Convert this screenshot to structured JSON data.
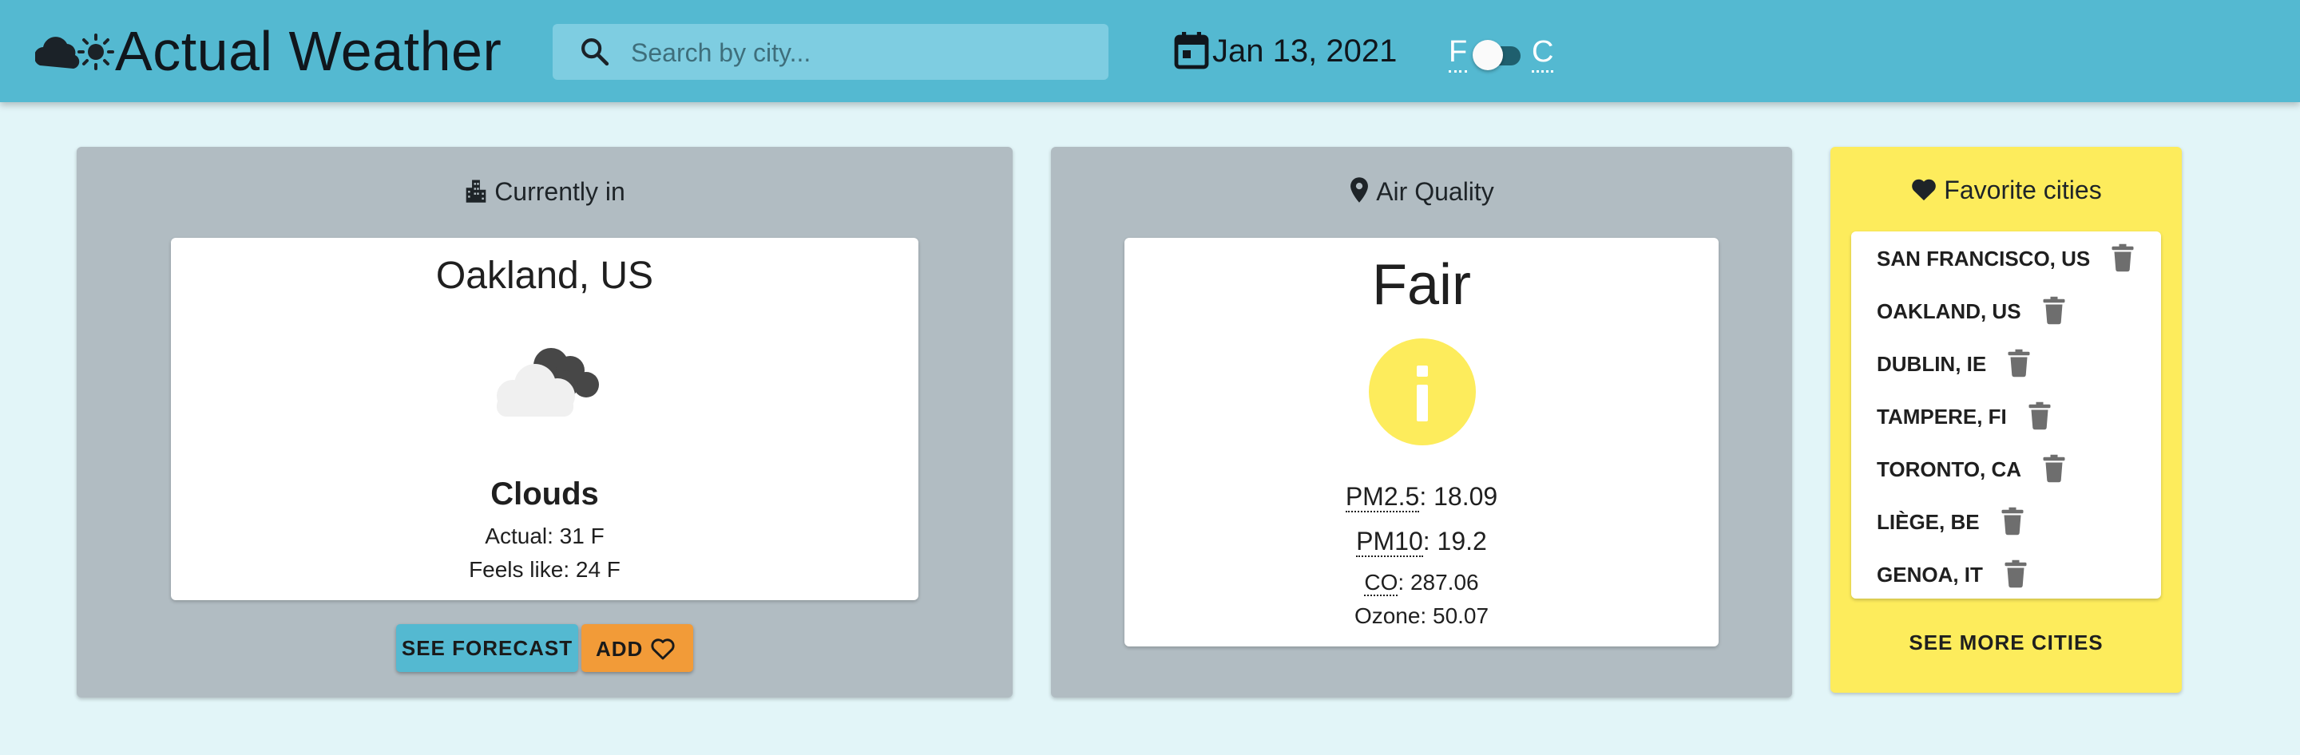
{
  "header": {
    "title": "Actual Weather",
    "logo_icons": [
      "cloud-icon",
      "sun-icon"
    ],
    "search": {
      "placeholder": "Search by city...",
      "value": ""
    },
    "date": "Jan 13, 2021",
    "unit_toggle": {
      "left_label": "F",
      "right_label": "C",
      "selected": "F"
    },
    "colors": {
      "bar": "#54b9d1",
      "search_bg": "#7ecde1"
    }
  },
  "current": {
    "heading": "Currently in",
    "heading_icon": "city-icon",
    "city": "Oakland, US",
    "weather_icon": "cloud-icon",
    "condition": "Clouds",
    "actual": "Actual: 31 F",
    "feels_like": "Feels like: 24 F",
    "forecast_button": "SEE FORECAST",
    "add_button": "ADD",
    "add_icon": "heart-outline-icon"
  },
  "air": {
    "heading": "Air Quality",
    "heading_icon": "location-pin-icon",
    "level": "Fair",
    "level_icon": "info-icon",
    "level_color": "#fdec5c",
    "pm25_label": "PM2.5",
    "pm25_value": ": 18.09",
    "pm10_label": "PM10",
    "pm10_value": ": 19.2",
    "co_label": "CO",
    "co_value": ": 287.06",
    "ozone": "Ozone: 50.07"
  },
  "favorites": {
    "heading": "Favorite cities",
    "heading_icon": "heart-icon",
    "cities": [
      "SAN FRANCISCO, US",
      "OAKLAND, US",
      "DUBLIN, IE",
      "TAMPERE, FI",
      "TORONTO, CA",
      "LIÈGE, BE",
      "GENOA, IT"
    ],
    "delete_icon": "trash-icon",
    "more_button": "SEE MORE CITIES",
    "panel_color": "#fdec5c"
  }
}
